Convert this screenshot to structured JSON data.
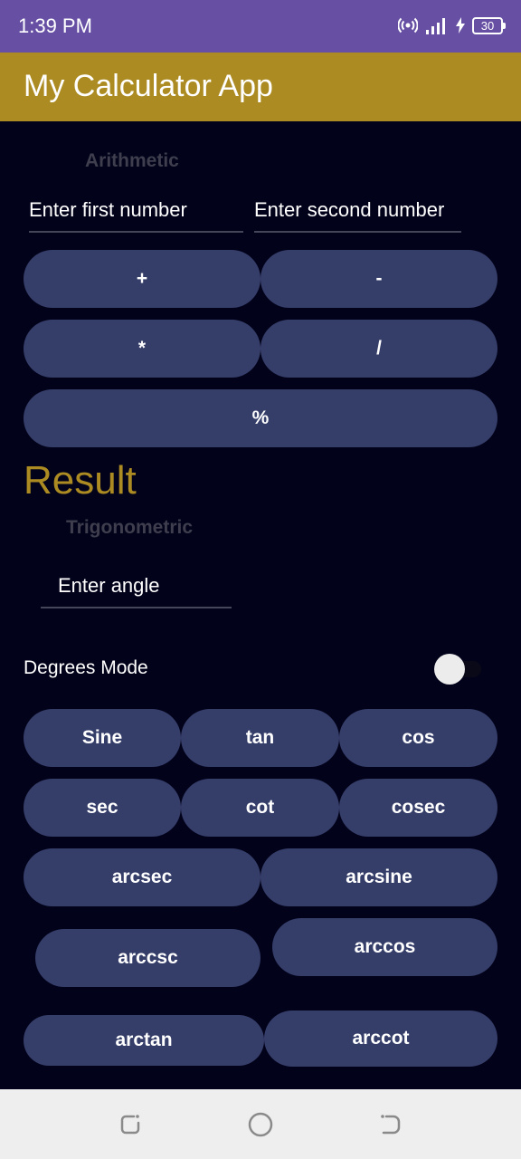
{
  "status_bar": {
    "time": "1:39 PM",
    "battery": "30",
    "icons": [
      "hotspot-icon",
      "signal-icon",
      "charging-bolt-icon",
      "battery-icon"
    ]
  },
  "app_bar": {
    "title": "My Calculator App"
  },
  "arithmetic": {
    "section_label": "Arithmetic",
    "first_number_placeholder": "Enter first number",
    "second_number_placeholder": "Enter second number",
    "buttons": {
      "add": "+",
      "subtract": "-",
      "multiply": "*",
      "divide": "/",
      "percent": "%"
    }
  },
  "result_label": "Result",
  "trigonometric": {
    "section_label": "Trigonometric",
    "angle_placeholder": "Enter angle",
    "degrees_mode_label": "Degrees Mode",
    "degrees_mode_on": false,
    "buttons": {
      "sine": "Sine",
      "tan": "tan",
      "cos": "cos",
      "sec": "sec",
      "cot": "cot",
      "cosec": "cosec",
      "arcsec": "arcsec",
      "arcsine": "arcsine",
      "arccsc": "arccsc",
      "arccos": "arccos",
      "arctan": "arctan",
      "arccot": "arccot"
    }
  },
  "nav_bar": {
    "icons": [
      "recents-icon",
      "home-icon",
      "back-icon"
    ]
  },
  "colors": {
    "status_bar": "#6750a4",
    "app_bar": "#ac8b22",
    "background": "#02021a",
    "button": "#353d69",
    "result_text": "#ac8b22"
  }
}
